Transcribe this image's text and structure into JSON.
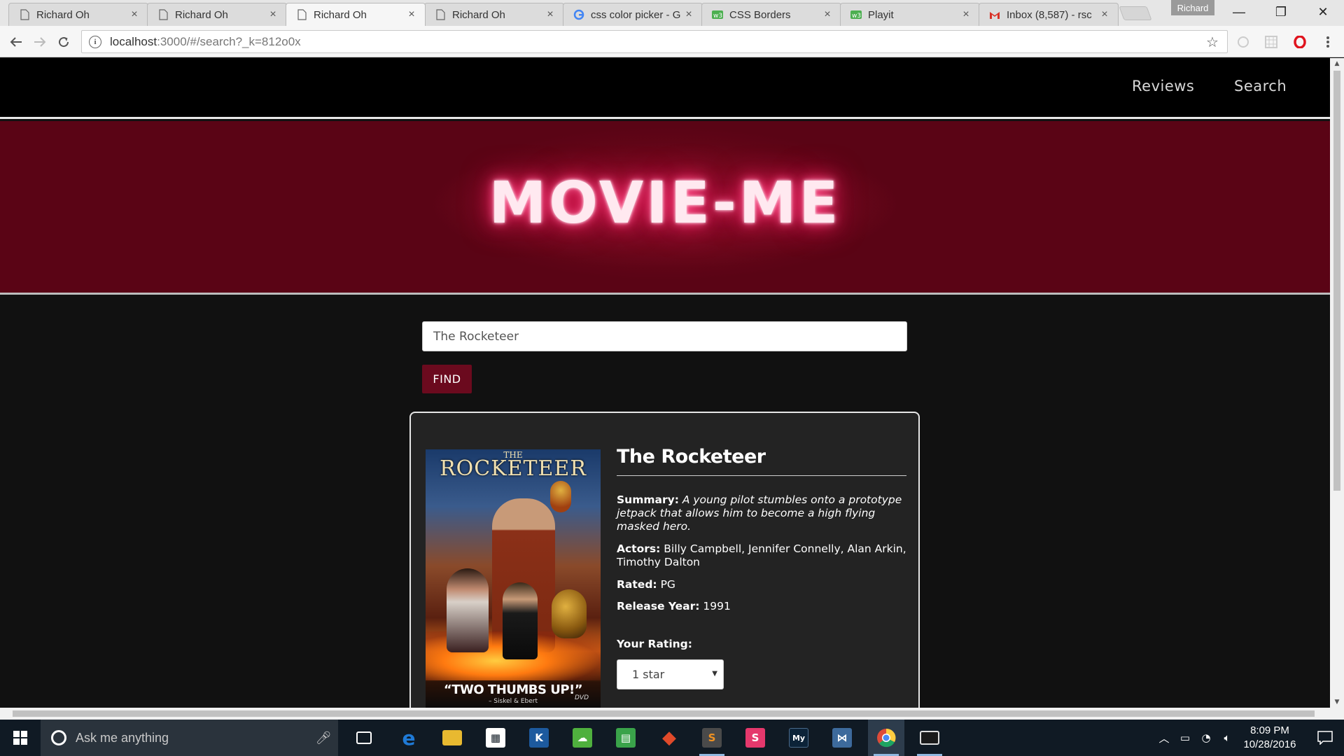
{
  "browser": {
    "tabs": [
      {
        "title": "Richard Oh",
        "favicon": "page-icon",
        "active": false
      },
      {
        "title": "Richard Oh",
        "favicon": "page-icon",
        "active": false
      },
      {
        "title": "Richard Oh",
        "favicon": "page-icon",
        "active": true
      },
      {
        "title": "Richard Oh",
        "favicon": "page-icon",
        "active": false
      },
      {
        "title": "css color picker - G",
        "favicon": "google-icon",
        "active": false
      },
      {
        "title": "CSS Borders",
        "favicon": "w3schools-icon",
        "active": false
      },
      {
        "title": "Playit",
        "favicon": "w3schools-icon",
        "active": false
      },
      {
        "title": "Inbox (8,587) - rsc",
        "favicon": "gmail-icon",
        "active": false
      }
    ],
    "tab_close_glyph": "×",
    "profile_name": "Richard",
    "window_controls": {
      "minimize": "—",
      "restore": "❐",
      "close": "✕"
    },
    "url_host": "localhost",
    "url_rest": ":3000/#/search?_k=812o0x"
  },
  "site": {
    "nav": {
      "reviews": "Reviews",
      "search": "Search"
    },
    "logo": "MOVIE-ME",
    "search": {
      "value": "The Rocketeer",
      "button_label": "FIND"
    },
    "result": {
      "title": "The Rocketeer",
      "poster": {
        "title_small": "THE",
        "title": "ROCKETEER",
        "quote": "“TWO THUMBS UP!”",
        "credit": "– Siskel & Ebert",
        "badge": "DVD"
      },
      "summary_label": "Summary:",
      "summary": "A young pilot stumbles onto a prototype jetpack that allows him to become a high flying masked hero.",
      "actors_label": "Actors:",
      "actors": "Billy Campbell, Jennifer Connelly, Alan Arkin, Timothy Dalton",
      "rated_label": "Rated:",
      "rated": "PG",
      "release_label": "Release Year:",
      "release_year": "1991",
      "rating_label": "Your Rating:",
      "rating_value": "1 star"
    }
  },
  "taskbar": {
    "search_placeholder": "Ask me anything",
    "apps": [
      {
        "name": "task-view",
        "label": "⧉",
        "color": "#101a24"
      },
      {
        "name": "edge",
        "label": "e",
        "color": "#1f7ad6"
      },
      {
        "name": "file-explorer",
        "label": "▬",
        "color": "#e8b930"
      },
      {
        "name": "store",
        "label": "▦",
        "color": "#ffffff"
      },
      {
        "name": "kindle",
        "label": "K",
        "color": "#1d5a9e"
      },
      {
        "name": "evernote-like",
        "label": "☁",
        "color": "#4fb03e"
      },
      {
        "name": "notes",
        "label": "▤",
        "color": "#3aa34a"
      },
      {
        "name": "git",
        "label": "◆",
        "color": "#e04a2a"
      },
      {
        "name": "sublime-text",
        "label": "S",
        "color": "#f29322"
      },
      {
        "name": "slack",
        "label": "S",
        "color": "#e5386c"
      },
      {
        "name": "mysql",
        "label": "My",
        "color": "#0c2338"
      },
      {
        "name": "visual-studio",
        "label": "⋈",
        "color": "#3d6a9c"
      },
      {
        "name": "chrome",
        "label": "●",
        "color": "#dd4b39"
      },
      {
        "name": "terminal",
        "label": "▭",
        "color": "#1a1a1a"
      }
    ],
    "clock_time": "8:09 PM",
    "clock_date": "10/28/2016"
  }
}
